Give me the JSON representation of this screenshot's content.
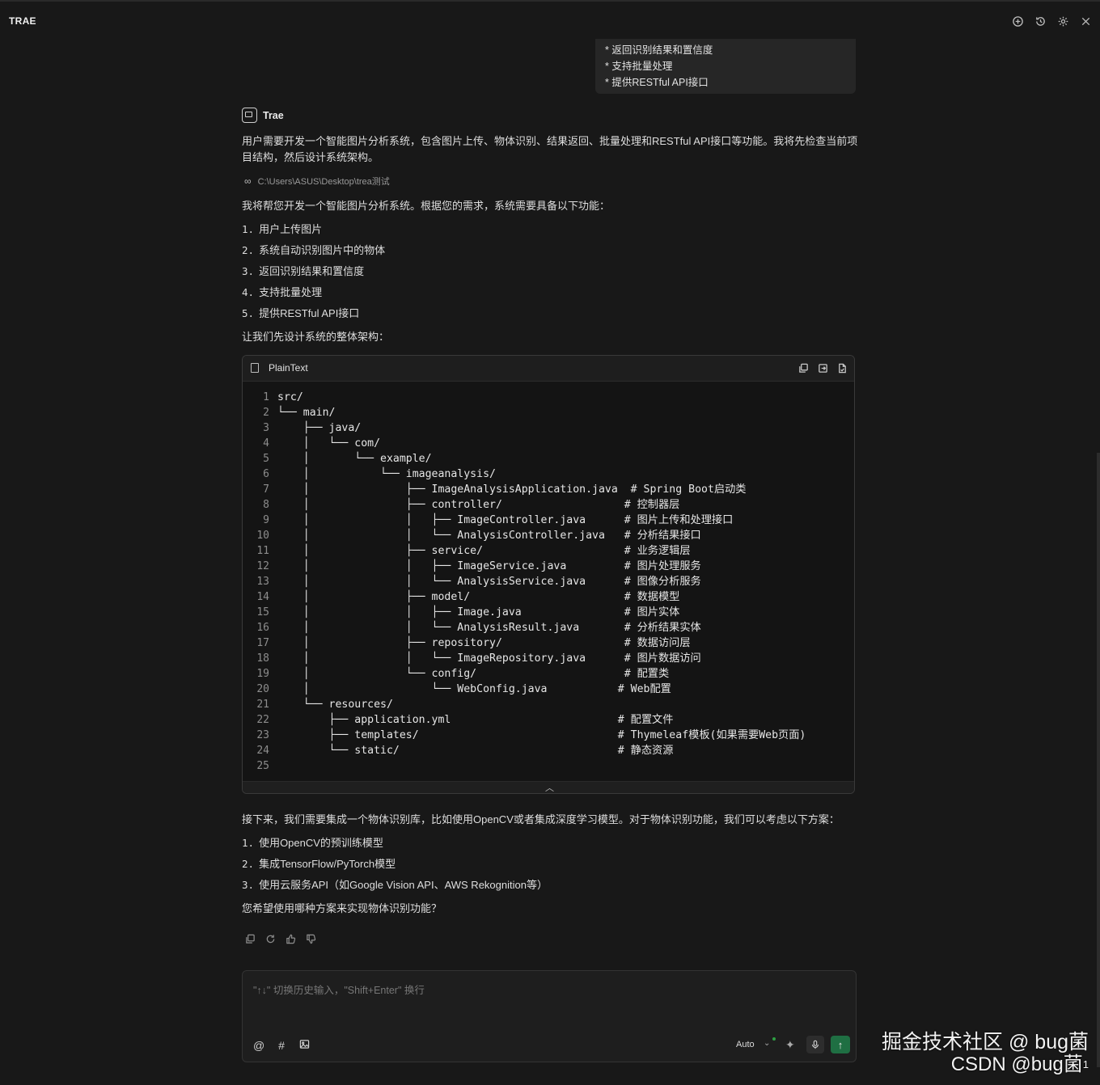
{
  "app": {
    "title": "TRAE"
  },
  "user_message": {
    "lines": [
      "* 返回识别结果和置信度",
      "* 支持批量处理",
      "* 提供RESTful API接口"
    ]
  },
  "assistant": {
    "name": "Trae",
    "thinking": "用户需要开发一个智能图片分析系统，包含图片上传、物体识别、结果返回、批量处理和RESTful API接口等功能。我将先检查当前项目结构，然后设计系统架构。",
    "workspace_path": "C:\\Users\\ASUS\\Desktop\\trea测试",
    "intro": "我将帮您开发一个智能图片分析系统。根据您的需求，系统需要具备以下功能：",
    "features": [
      {
        "num": "1.",
        "text": "用户上传图片"
      },
      {
        "num": "2.",
        "text": "系统自动识别图片中的物体"
      },
      {
        "num": "3.",
        "text": "返回识别结果和置信度"
      },
      {
        "num": "4.",
        "text": "支持批量处理"
      },
      {
        "num": "5.",
        "text": "提供RESTful API接口"
      }
    ],
    "design_intro": "让我们先设计系统的整体架构：",
    "code_block": {
      "language": "PlainText",
      "lines": [
        "src/",
        "└── main/",
        "    ├── java/",
        "    │   └── com/",
        "    │       └── example/",
        "    │           └── imageanalysis/",
        "    │               ├── ImageAnalysisApplication.java  # Spring Boot启动类",
        "    │               ├── controller/                   # 控制器层",
        "    │               │   ├── ImageController.java      # 图片上传和处理接口",
        "    │               │   └── AnalysisController.java   # 分析结果接口",
        "    │               ├── service/                      # 业务逻辑层",
        "    │               │   ├── ImageService.java         # 图片处理服务",
        "    │               │   └── AnalysisService.java      # 图像分析服务",
        "    │               ├── model/                        # 数据模型",
        "    │               │   ├── Image.java                # 图片实体",
        "    │               │   └── AnalysisResult.java       # 分析结果实体",
        "    │               ├── repository/                   # 数据访问层",
        "    │               │   └── ImageRepository.java      # 图片数据访问",
        "    │               └── config/                       # 配置类",
        "    │                   └── WebConfig.java           # Web配置",
        "    └── resources/",
        "        ├── application.yml                          # 配置文件",
        "        ├── templates/                               # Thymeleaf模板(如果需要Web页面)",
        "        └── static/                                  # 静态资源",
        ""
      ]
    },
    "options_intro": "接下来，我们需要集成一个物体识别库，比如使用OpenCV或者集成深度学习模型。对于物体识别功能，我们可以考虑以下方案：",
    "options": [
      {
        "num": "1.",
        "text": "使用OpenCV的预训练模型"
      },
      {
        "num": "2.",
        "text": "集成TensorFlow/PyTorch模型"
      },
      {
        "num": "3.",
        "text": "使用云服务API（如Google Vision API、AWS Rekognition等）"
      }
    ],
    "question": "您希望使用哪种方案来实现物体识别功能？"
  },
  "input": {
    "placeholder": "\"↑↓\" 切换历史输入，\"Shift+Enter\" 换行",
    "mode": "Auto"
  },
  "watermark": {
    "line1": "掘金技术社区 @ bug菌",
    "line2": "CSDN @bug菌",
    "sup": "1"
  },
  "icons": {
    "top": [
      "new-chat-icon",
      "history-icon",
      "settings-icon",
      "close-icon"
    ],
    "code_actions": [
      "copy-icon",
      "insert-icon",
      "apply-icon"
    ],
    "feedback": [
      "copy-icon",
      "regenerate-icon",
      "thumbs-up-icon",
      "thumbs-down-icon"
    ],
    "input_tools": [
      "mention-icon",
      "hash-icon",
      "image-icon",
      "sparkle-icon",
      "mic-icon",
      "send-icon"
    ]
  },
  "colors": {
    "background": "#181818",
    "send_button": "#1f6f43",
    "status_dot": "#2ea043"
  }
}
